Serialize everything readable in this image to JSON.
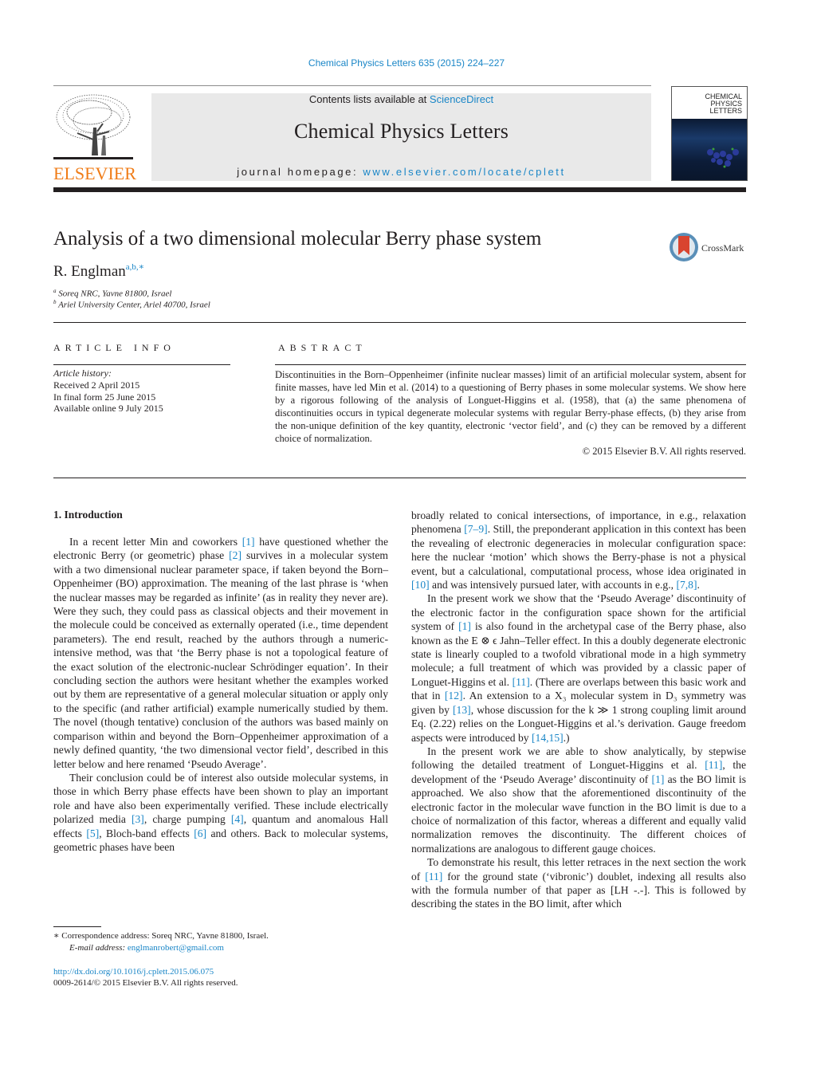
{
  "header": {
    "journal_ref": "Chemical Physics Letters 635 (2015) 224–227",
    "contents_prefix": "Contents lists available at ",
    "contents_link": "ScienceDirect",
    "journal_name": "Chemical Physics Letters",
    "homepage_prefix": "journal homepage: ",
    "homepage_link": "www.elsevier.com/locate/cplett",
    "publisher_logo_text": "ELSEVIER",
    "cover_title": "CHEMICAL\nPHYSICS\nLETTERS"
  },
  "article": {
    "title": "Analysis of a two dimensional molecular Berry phase system",
    "crossmark_label": "CrossMark",
    "author": "R. Englman",
    "author_marks": "a,b,∗",
    "affiliations": [
      {
        "mark": "a",
        "text": "Soreq NRC, Yavne 81800, Israel"
      },
      {
        "mark": "b",
        "text": "Ariel University Center, Ariel 40700, Israel"
      }
    ]
  },
  "article_info": {
    "heading": "ARTICLE INFO",
    "history_label": "Article history:",
    "received": "Received 2 April 2015",
    "final_form": "In final form 25 June 2015",
    "online": "Available online 9 July 2015"
  },
  "abstract": {
    "heading": "ABSTRACT",
    "text": "Discontinuities in the Born–Oppenheimer (infinite nuclear masses) limit of an artificial molecular system, absent for finite masses, have led Min et al. (2014) to a questioning of Berry phases in some molecular systems. We show here by a rigorous following of the analysis of Longuet-Higgins et al. (1958), that (a) the same phenomena of discontinuities occurs in typical degenerate molecular systems with regular Berry-phase effects, (b) they arise from the non-unique definition of the key quantity, electronic ‘vector field’, and (c) they can be removed by a different choice of normalization.",
    "copyright": "© 2015 Elsevier B.V. All rights reserved."
  },
  "body": {
    "section_heading": "1.  Introduction",
    "left": {
      "p1": [
        "In a recent letter Min and coworkers ",
        "[1]",
        " have questioned whether the electronic Berry (or geometric) phase ",
        "[2]",
        " survives in a molecular system with a two dimensional nuclear parameter space, if taken beyond the Born–Oppenheimer (BO) approximation. The meaning of the last phrase is ‘when the nuclear masses may be regarded as infinite’ (as in reality they never are). Were they such, they could pass as classical objects and their movement in the molecule could be conceived as externally operated (i.e., time dependent parameters). The end result, reached by the authors through a numeric-intensive method, was that ‘the Berry phase is not a topological feature of the exact solution of the electronic-nuclear Schrödinger equation’. In their concluding section the authors were hesitant whether the examples worked out by them are representative of a general molecular situation or apply only to the specific (and rather artificial) example numerically studied by them. The novel (though tentative) conclusion of the authors was based mainly on comparison within and beyond the Born–Oppenheimer approximation of a newly defined quantity, ‘the two dimensional vector field’, described in this letter below and here renamed ‘Pseudo Average’."
      ],
      "p2": [
        "Their conclusion could be of interest also outside molecular systems, in those in which Berry phase effects have been shown to play an important role and have also been experimentally verified. These include electrically polarized media ",
        "[3]",
        ", charge pumping ",
        "[4]",
        ", quantum and anomalous Hall effects ",
        "[5]",
        ", Bloch-band effects ",
        "[6]",
        " and others. Back to molecular systems, geometric phases have been"
      ]
    },
    "right": {
      "p1": [
        "broadly related to conical intersections, of importance, in e.g., relaxation phenomena ",
        "[7–9]",
        ". Still, the preponderant application in this context has been the revealing of electronic degeneracies in molecular configuration space: here the nuclear ‘motion’ which shows the Berry-phase is not a physical event, but a calculational, computational process, whose idea originated in ",
        "[10]",
        " and was intensively pursued later, with accounts in e.g., ",
        "[7,8]",
        "."
      ],
      "p2": [
        "In the present work we show that the ‘Pseudo Average’ discontinuity of the electronic factor in the configuration space shown for the artificial system of ",
        "[1]",
        " is also found in the archetypal case of the Berry phase, also known as the E ⊗ ϵ Jahn–Teller effect. In this a doubly degenerate electronic state is linearly coupled to a twofold vibrational mode in a high symmetry molecule; a full treatment of which was provided by a classic paper of Longuet-Higgins et al. ",
        "[11]",
        ". (There are overlaps between this basic work and that in ",
        "[12]",
        ". An extension to a X₃ molecular system in D₃ symmetry was given by ",
        "[13]",
        ", whose discussion for the k ≫ 1 strong coupling limit around Eq. (2.22) relies on the Longuet-Higgins et al.’s derivation. Gauge freedom aspects were introduced by ",
        "[14,15]",
        ".)"
      ],
      "p3": [
        "In the present work we are able to show analytically, by stepwise following the detailed treatment of Longuet-Higgins et al. ",
        "[11]",
        ", the development of the ‘Pseudo Average’ discontinuity of ",
        "[1]",
        " as the BO limit is approached. We also show that the aforementioned discontinuity of the electronic factor in the molecular wave function in the BO limit is due to a choice of normalization of this factor, whereas a different and equally valid normalization removes the discontinuity. The different choices of normalizations are analogous to different gauge choices."
      ],
      "p4": [
        "To demonstrate his result, this letter retraces in the next section the work of ",
        "[11]",
        " for the ground state (‘vibronic’) doublet, indexing all results also with the formula number of that paper as [LH -.-]. This is followed by describing the states in the BO limit, after which"
      ]
    }
  },
  "footnotes": {
    "correspondence": "∗  Correspondence address: Soreq NRC, Yavne 81800, Israel.",
    "email_label": "E-mail address: ",
    "email": "englmanrobert@gmail.com",
    "doi": "http://dx.doi.org/10.1016/j.cplett.2015.06.075",
    "issn_copyright": "0009-2614/© 2015 Elsevier B.V. All rights reserved."
  },
  "colors": {
    "link": "#1a86c7",
    "elsevier_orange": "#f07c17",
    "banner_gray": "#e9e9e9",
    "text": "#231f20"
  }
}
